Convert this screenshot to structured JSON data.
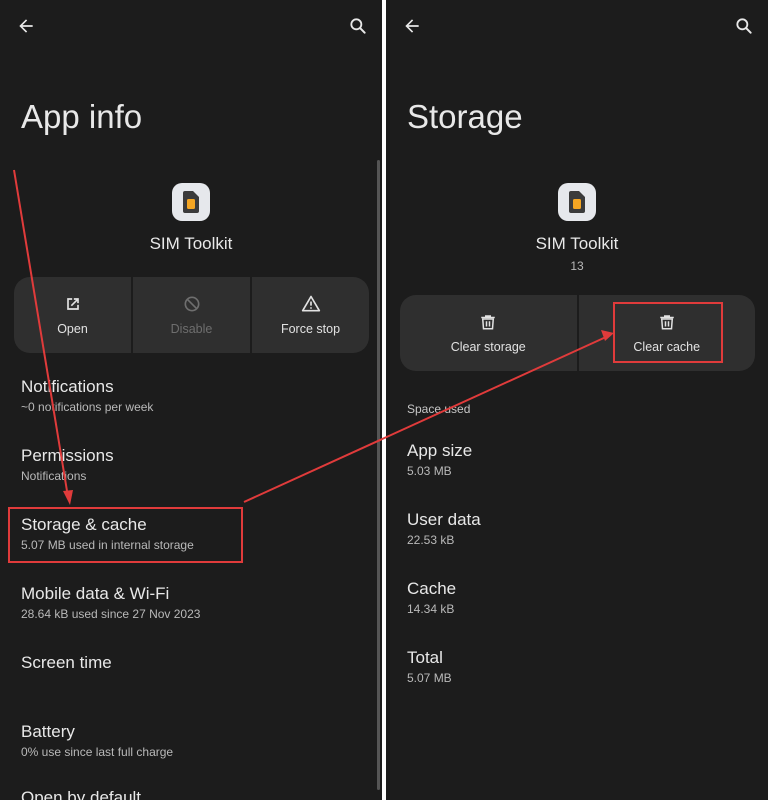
{
  "left": {
    "title": "App info",
    "app_name": "SIM Toolkit",
    "actions": [
      {
        "label": "Open",
        "icon": "open-external-icon",
        "enabled": true
      },
      {
        "label": "Disable",
        "icon": "disable-icon",
        "enabled": false
      },
      {
        "label": "Force stop",
        "icon": "warning-icon",
        "enabled": true
      }
    ],
    "items": [
      {
        "title": "Notifications",
        "subtitle": "~0 notifications per week"
      },
      {
        "title": "Permissions",
        "subtitle": "Notifications"
      },
      {
        "title": "Storage & cache",
        "subtitle": "5.07 MB used in internal storage"
      },
      {
        "title": "Mobile data & Wi-Fi",
        "subtitle": "28.64 kB used since 27 Nov 2023"
      },
      {
        "title": "Screen time",
        "subtitle": ""
      },
      {
        "title": "Battery",
        "subtitle": "0% use since last full charge"
      },
      {
        "title": "Open by default",
        "subtitle": ""
      }
    ]
  },
  "right": {
    "title": "Storage",
    "app_name": "SIM Toolkit",
    "app_version": "13",
    "actions": [
      {
        "label": "Clear storage",
        "icon": "trash-icon"
      },
      {
        "label": "Clear cache",
        "icon": "trash-icon"
      }
    ],
    "section_label": "Space used",
    "stats": [
      {
        "title": "App size",
        "value": "5.03 MB"
      },
      {
        "title": "User data",
        "value": "22.53 kB"
      },
      {
        "title": "Cache",
        "value": "14.34 kB"
      },
      {
        "title": "Total",
        "value": "5.07 MB"
      }
    ]
  },
  "colors": {
    "background": "#1c1c1c",
    "surface": "#2f2f2f",
    "annotation": "#e03b3b",
    "app_icon_accent": "#f5a623"
  }
}
